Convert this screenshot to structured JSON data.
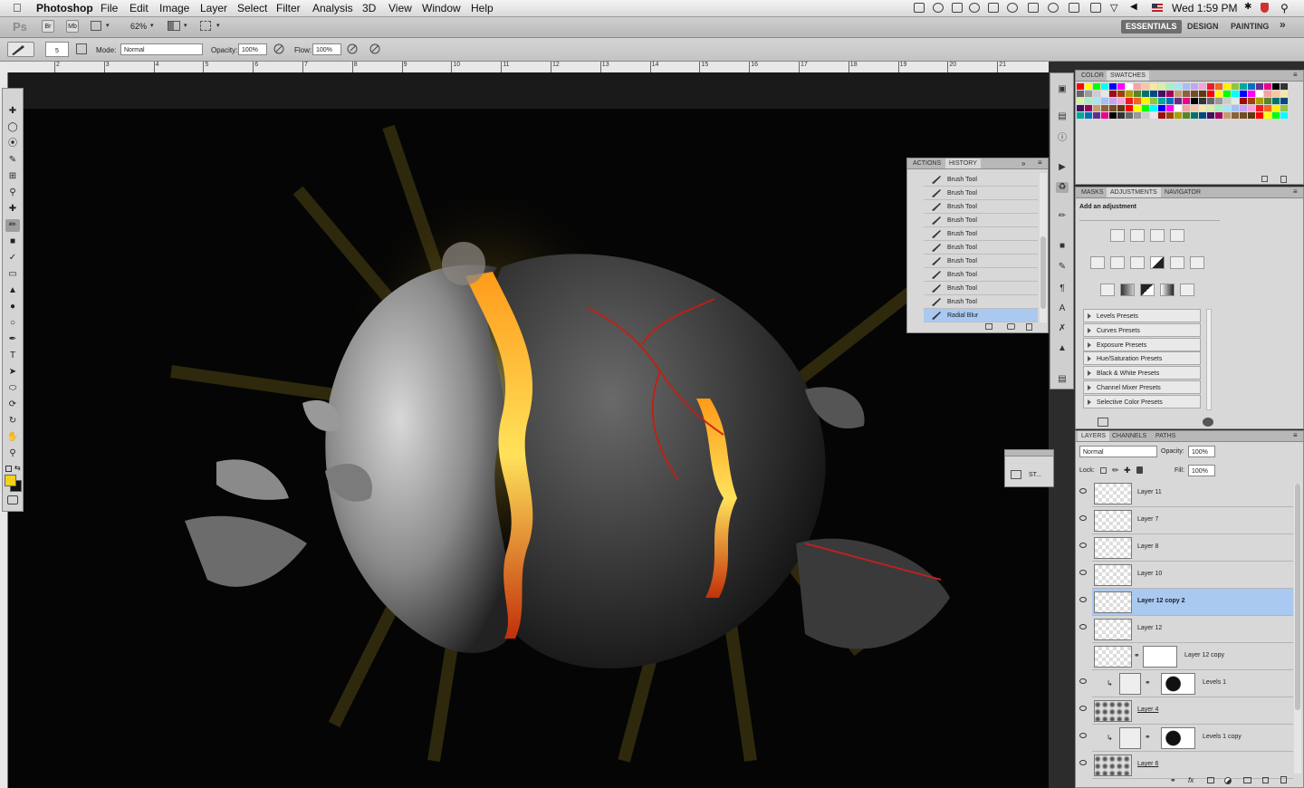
{
  "menubar": {
    "app": "Photoshop",
    "items": [
      "File",
      "Edit",
      "Image",
      "Layer",
      "Select",
      "Filter",
      "Analysis",
      "3D",
      "View",
      "Window",
      "Help"
    ],
    "clock": "Wed 1:59 PM"
  },
  "appbar": {
    "logo": "Ps",
    "btn_br": "Br",
    "btn_mb": "Mb",
    "zoom": "62%",
    "workspaces": [
      "ESSENTIALS",
      "DESIGN",
      "PAINTING"
    ],
    "more": "»"
  },
  "options": {
    "brush_size": "5",
    "mode_label": "Mode:",
    "mode_value": "Normal",
    "opacity_label": "Opacity:",
    "opacity_value": "100%",
    "flow_label": "Flow:",
    "flow_value": "100%"
  },
  "ruler": {
    "ticks": [
      "2",
      "3",
      "4",
      "5",
      "6",
      "7",
      "8",
      "9",
      "10",
      "11",
      "12",
      "13",
      "14",
      "15",
      "16",
      "17",
      "18",
      "19",
      "20",
      "21"
    ]
  },
  "history_panel": {
    "tabs": [
      "ACTIONS",
      "HISTORY"
    ],
    "active_tab": "HISTORY",
    "items": [
      "Brush Tool",
      "Brush Tool",
      "Brush Tool",
      "Brush Tool",
      "Brush Tool",
      "Brush Tool",
      "Brush Tool",
      "Brush Tool",
      "Brush Tool",
      "Brush Tool",
      "Radial Blur"
    ],
    "selected_index": 10
  },
  "mini_panel": {
    "label": "ST..."
  },
  "color_panel": {
    "tabs": [
      "COLOR",
      "SWATCHES"
    ],
    "active_tab": "SWATCHES",
    "swatch_colors": [
      "#ff0000",
      "#ffff00",
      "#00ff00",
      "#00ffff",
      "#0000ff",
      "#ff00ff",
      "#ffffff",
      "#f5a3a3",
      "#f7c7a3",
      "#f9e6a3",
      "#d8f0a3",
      "#a3f0c2",
      "#a3e6f5",
      "#a3bff5",
      "#c5a3f5",
      "#f5a3d9",
      "#ed1c24",
      "#f26522",
      "#fff200",
      "#8dc63f",
      "#00a99d",
      "#0072bc",
      "#662d91",
      "#ec008c",
      "#000000",
      "#333333",
      "#666666",
      "#999999",
      "#cccccc",
      "#e6e6e6",
      "#9e0b0f",
      "#a0410d",
      "#aba000",
      "#598527",
      "#00746b",
      "#004a80",
      "#440e62",
      "#9e005d",
      "#c69c6d",
      "#8c6239",
      "#754c24",
      "#603913"
    ],
    "accent": "#f3d21a"
  },
  "adjustments_panel": {
    "tabs": [
      "MASKS",
      "ADJUSTMENTS",
      "NAVIGATOR"
    ],
    "active_tab": "ADJUSTMENTS",
    "heading": "Add an adjustment",
    "presets": [
      "Levels Presets",
      "Curves Presets",
      "Exposure Presets",
      "Hue/Saturation Presets",
      "Black & White Presets",
      "Channel Mixer Presets",
      "Selective Color Presets"
    ]
  },
  "layers_panel": {
    "tabs": [
      "LAYERS",
      "CHANNELS",
      "PATHS"
    ],
    "active_tab": "LAYERS",
    "blend_mode": "Normal",
    "opacity_label": "Opacity:",
    "opacity_value": "100%",
    "lock_label": "Lock:",
    "fill_label": "Fill:",
    "fill_value": "100%",
    "layers": [
      {
        "name": "Layer 11",
        "visible": true,
        "type": "pixel"
      },
      {
        "name": "Layer 7",
        "visible": true,
        "type": "pixel"
      },
      {
        "name": "Layer 8",
        "visible": true,
        "type": "pixel"
      },
      {
        "name": "Layer 10",
        "visible": true,
        "type": "pixel"
      },
      {
        "name": "Layer 12 copy 2",
        "visible": true,
        "type": "pixel",
        "selected": true
      },
      {
        "name": "Layer 12",
        "visible": true,
        "type": "pixel"
      },
      {
        "name": "Layer 12 copy",
        "visible": false,
        "type": "masked"
      },
      {
        "name": "Levels 1",
        "visible": true,
        "type": "adjustment"
      },
      {
        "name": "Layer 4",
        "visible": true,
        "type": "image"
      },
      {
        "name": "Levels 1 copy",
        "visible": true,
        "type": "adjustment"
      },
      {
        "name": "Layer 6",
        "visible": true,
        "type": "image"
      }
    ]
  }
}
